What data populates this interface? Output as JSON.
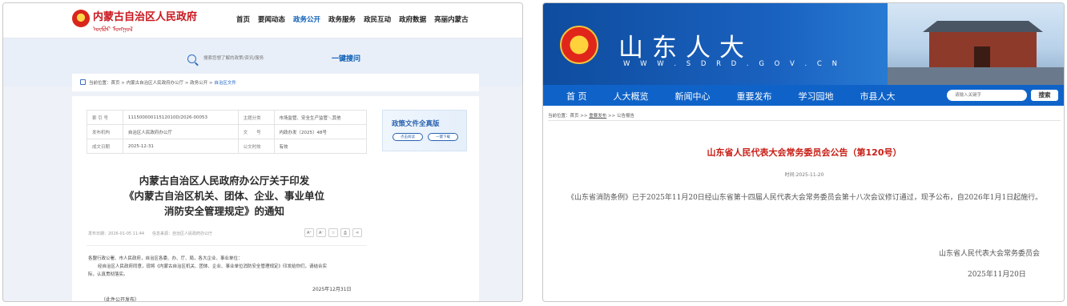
{
  "left": {
    "site_title": "内蒙古自治区人民政府",
    "site_subtitle": "ᠥᠪᠥᠷ ᠮᠣᠩᠭᠣᠯ",
    "nav": [
      "首页",
      "要闻动态",
      "政务公开",
      "政务服务",
      "政民互动",
      "政府数据",
      "亮丽内蒙古"
    ],
    "nav_active_index": 2,
    "search": {
      "placeholder": "搜索您想了解的政策/资讯/服务",
      "button": "一键搜问"
    },
    "breadcrumb": {
      "prefix": "当前位置：首页 > 内蒙古自治区人民政府办公厅 > 政务公开 > ",
      "current": "自治区文件"
    },
    "meta_table": [
      [
        "索 引 号",
        "11150000011512010D/2026-00053",
        "主题分类",
        "市场监管、安全生产监管＼其他"
      ],
      [
        "发布机构",
        "自治区人民政府办公厅",
        "文　　号",
        "内政办发〔2025〕48号"
      ],
      [
        "成文日期",
        "2025-12-31",
        "公文时效",
        "有效"
      ]
    ],
    "card": {
      "title": "政策文件全真版",
      "btn_view": "点击阅读",
      "btn_download": "一键下载"
    },
    "doc_title_lines": [
      "内蒙古自治区人民政府办公厅关于印发",
      "《内蒙古自治区机关、团体、企业、事业单位",
      "消防安全管理规定》的通知"
    ],
    "doc_meta": "发布日期：2026-01-05 11:44　　信息来源：自治区人民政府办公厅",
    "tools": [
      "A⁺",
      "A⁻",
      "☆",
      "⎙",
      "⋖"
    ],
    "body_lines": [
      "各盟行政公署、市人民政府，自治区各委、办、厅、局，各大企业、事业单位：",
      "经自治区人民政府同意，现将《内蒙古自治区机关、团体、企业、事业单位消防安全管理规定》印发给你们，请结合实",
      "际，认真贯彻落实。"
    ],
    "sign_date": "2025年12月31日",
    "public_note": "（此件公开发布）"
  },
  "right": {
    "site_title": "山东人大",
    "site_url": "W W W . S D R D . G O V . C N",
    "nav": [
      "首 页",
      "人大概览",
      "新闻中心",
      "重要发布",
      "学习园地",
      "市县人大"
    ],
    "search": {
      "placeholder": "请输入关键字",
      "button": "搜索"
    },
    "breadcrumb": {
      "prefix": "当前位置：首页 >> ",
      "link": "重要发布",
      "suffix": " >> 公告报告"
    },
    "headline": "山东省人民代表大会常务委员会公告（第120号）",
    "time": "时间:2025-11-20",
    "body": "《山东省消防条例》已于2025年11月20日经山东省第十四届人民代表大会常务委员会第十八次会议修订通过，现予公布，自2026年1月1日起施行。",
    "sign_org": "山东省人民代表大会常务委员会",
    "sign_date": "2025年11月20日",
    "colors": {
      "banner_blue": "#1a62c0",
      "nav_blue": "#0f63c8",
      "headline_red": "#c81d14"
    }
  }
}
